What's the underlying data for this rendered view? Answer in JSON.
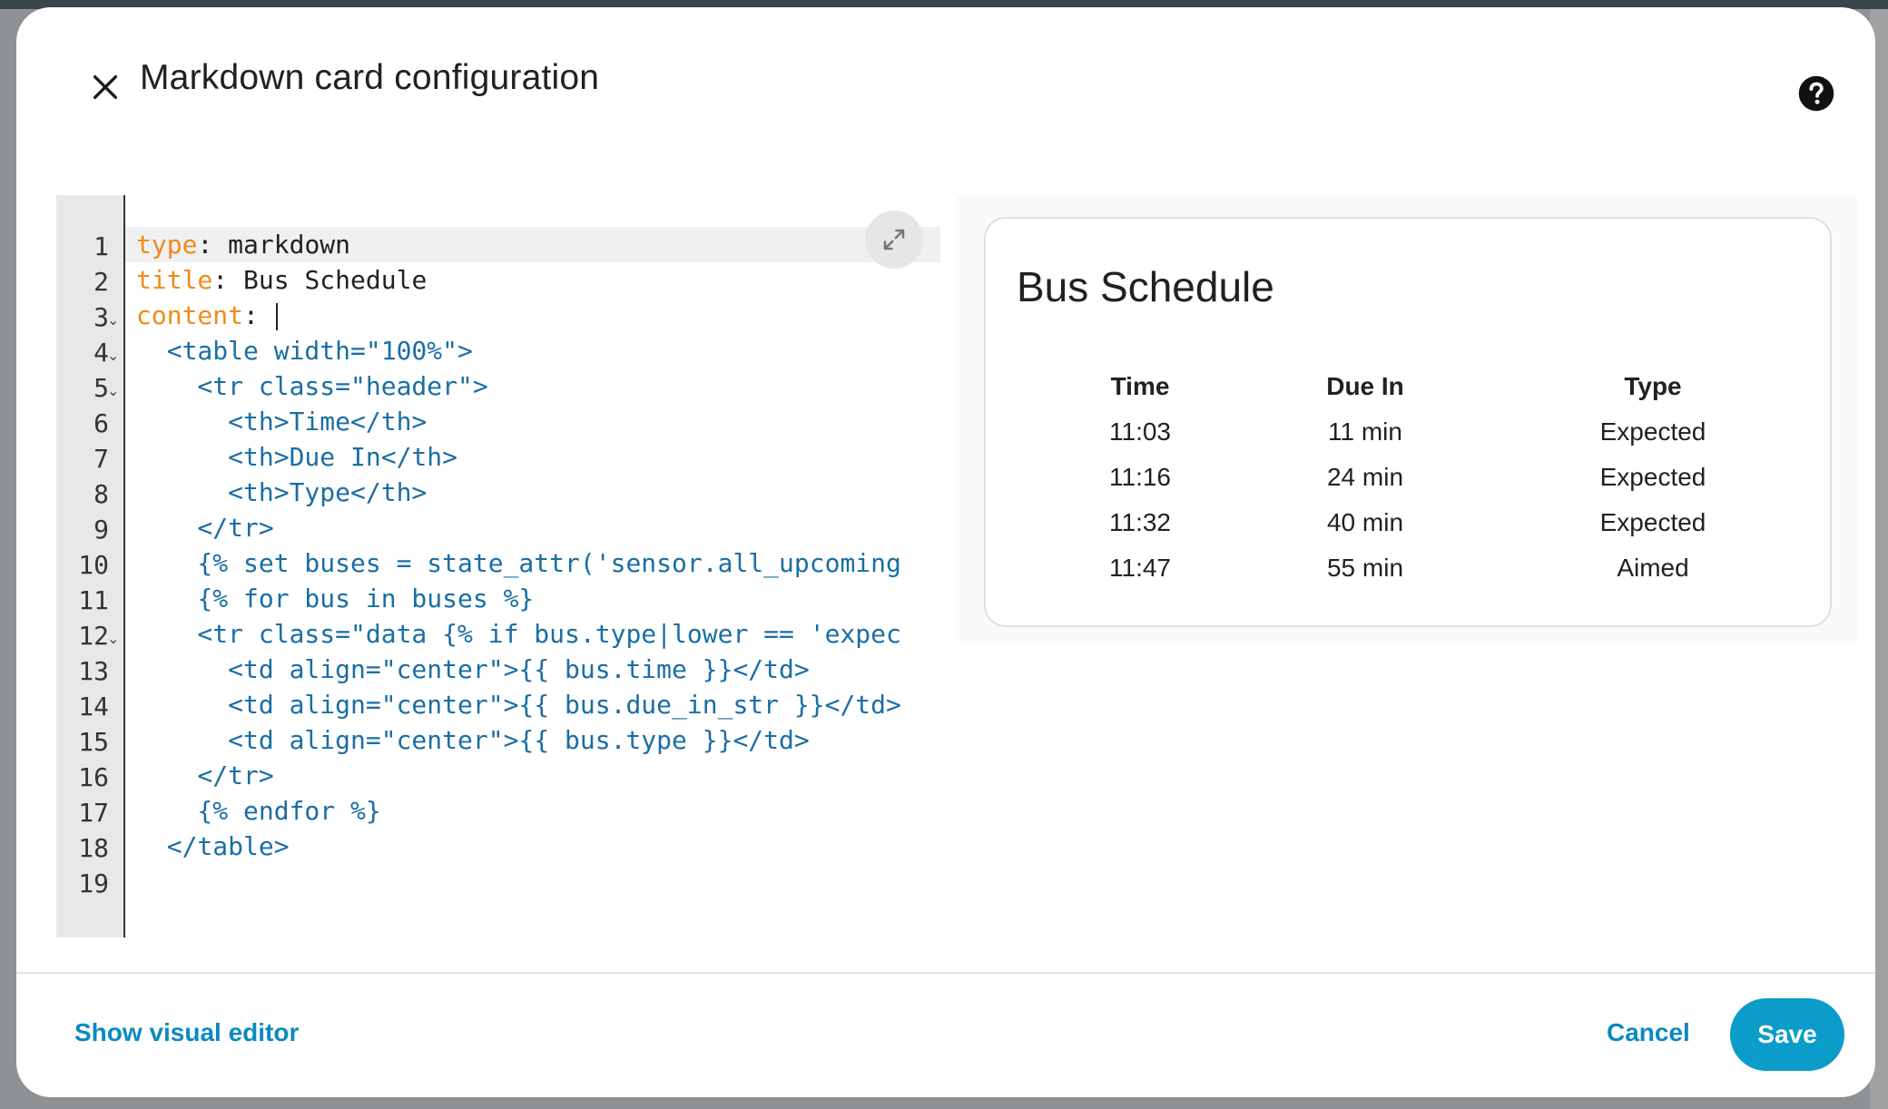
{
  "dialog": {
    "title": "Markdown card configuration",
    "close_icon": "close-icon",
    "help_icon": "help-circle-icon"
  },
  "editor": {
    "line_numbers": [
      "1",
      "2",
      "3",
      "4",
      "5",
      "6",
      "7",
      "8",
      "9",
      "10",
      "11",
      "12",
      "13",
      "14",
      "15",
      "16",
      "17",
      "18",
      "19"
    ],
    "lines": [
      {
        "key": "type",
        "value": "markdown"
      },
      {
        "key": "title",
        "value": "Bus Schedule"
      },
      {
        "key": "content",
        "value": ""
      },
      {
        "text": "  <table width=\"100%\">"
      },
      {
        "text": "    <tr class=\"header\">"
      },
      {
        "text": "      <th>Time</th>"
      },
      {
        "text": "      <th>Due In</th>"
      },
      {
        "text": "      <th>Type</th>"
      },
      {
        "text": "    </tr>"
      },
      {
        "text": "    {% set buses = state_attr('sensor.all_upcoming"
      },
      {
        "text": "    {% for bus in buses %}"
      },
      {
        "text": "    <tr class=\"data {% if bus.type|lower == 'expec"
      },
      {
        "text": "      <td align=\"center\">{{ bus.time }}</td>"
      },
      {
        "text": "      <td align=\"center\">{{ bus.due_in_str }}</td>"
      },
      {
        "text": "      <td align=\"center\">{{ bus.type }}</td>"
      },
      {
        "text": "    </tr>"
      },
      {
        "text": "    {% endfor %}"
      },
      {
        "text": "  </table>"
      },
      {
        "text": ""
      }
    ],
    "expand_icon": "expand-icon"
  },
  "preview": {
    "title": "Bus Schedule",
    "headers": [
      "Time",
      "Due In",
      "Type"
    ],
    "rows": [
      [
        "11:03",
        "11 min",
        "Expected"
      ],
      [
        "11:16",
        "24 min",
        "Expected"
      ],
      [
        "11:32",
        "40 min",
        "Expected"
      ],
      [
        "11:47",
        "55 min",
        "Aimed"
      ]
    ]
  },
  "footer": {
    "show_visual_label": "Show visual editor",
    "cancel_label": "Cancel",
    "save_label": "Save"
  },
  "colors": {
    "accent": "#0b9cc9",
    "link": "#0b8ac0",
    "yaml_key": "#ee8b1a",
    "code": "#1a6ea3"
  }
}
